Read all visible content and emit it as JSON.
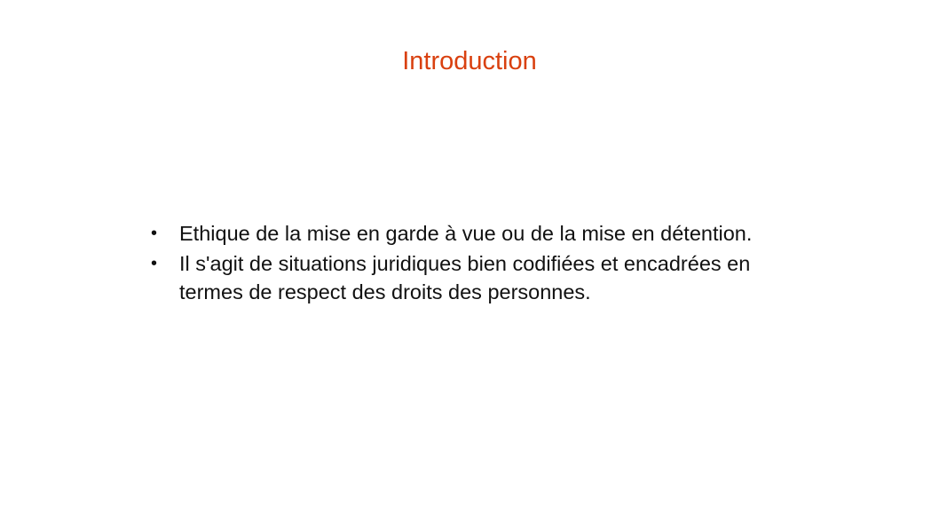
{
  "slide": {
    "title": "Introduction",
    "title_color": "#d9400f",
    "bullet_marker": "•",
    "bullets": [
      "Ethique de la mise en garde à vue ou de la mise en détention.",
      "Il s'agit de situations juridiques bien codifiées et encadrées en termes de respect des droits des personnes."
    ]
  }
}
